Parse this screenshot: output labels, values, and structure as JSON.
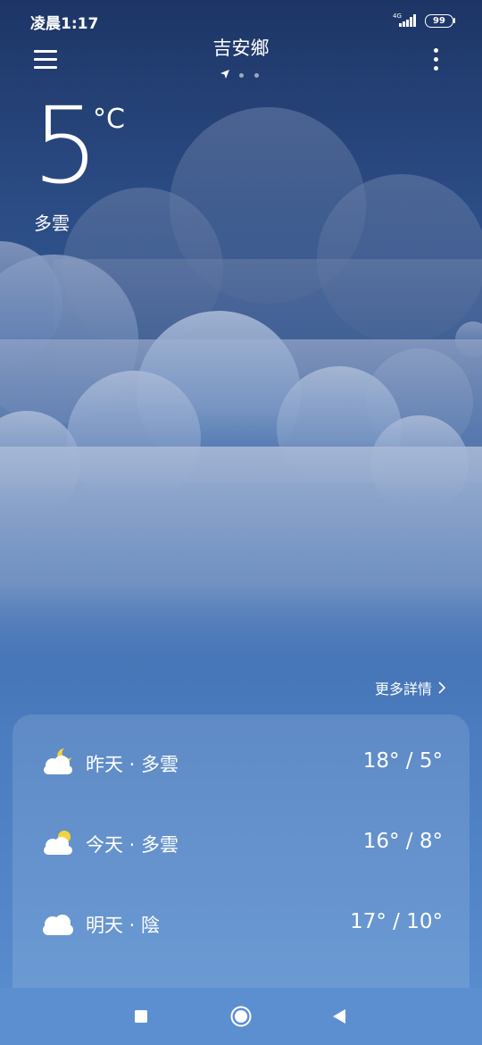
{
  "status_bar": {
    "time": "凌晨1:17",
    "network": "4G",
    "battery": "99"
  },
  "header": {
    "city": "吉安鄉",
    "menu_icon": "menu-icon",
    "more_icon": "more-vertical-icon",
    "location_icon": "location-arrow-icon"
  },
  "current": {
    "temperature": "5",
    "unit": "°C",
    "condition": "多雲"
  },
  "more_details": {
    "label": "更多詳情",
    "icon": "chevron-right-icon"
  },
  "forecast": [
    {
      "label": "昨天 · 多雲",
      "range": "18° / 5°",
      "icon": "partly-cloudy-night-icon"
    },
    {
      "label": "今天 · 多雲",
      "range": "16° / 8°",
      "icon": "partly-cloudy-day-icon"
    },
    {
      "label": "明天 · 陰",
      "range": "17° / 10°",
      "icon": "cloud-icon"
    }
  ],
  "nav_bar": {
    "recents_icon": "square-icon",
    "home_icon": "circle-icon",
    "back_icon": "triangle-back-icon"
  },
  "colors": {
    "sun": "#f2d33b",
    "cloud": "#ffffff",
    "background_top": "#1d3566",
    "background_bottom": "#5a8fd0"
  }
}
